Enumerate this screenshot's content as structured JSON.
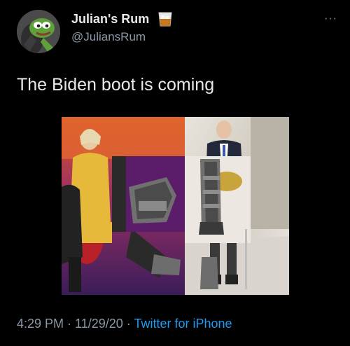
{
  "author": {
    "display_name": "Julian's Rum",
    "handle": "@JuliansRum",
    "avatar_icon": "frog-avatar-icon",
    "badge_icon": "rum-glass-icon"
  },
  "menu": {
    "more_icon": "more-options-icon",
    "more_glyph": "···"
  },
  "tweet": {
    "text": "The Biden boot is coming"
  },
  "meta": {
    "time": "4:29 PM",
    "separator1": " · ",
    "date": "11/29/20",
    "separator2": " · ",
    "source": "Twitter for iPhone"
  },
  "colors": {
    "background": "#000000",
    "text": "#e7e9ea",
    "secondary": "#8b98a5",
    "link": "#1d9bf0"
  }
}
